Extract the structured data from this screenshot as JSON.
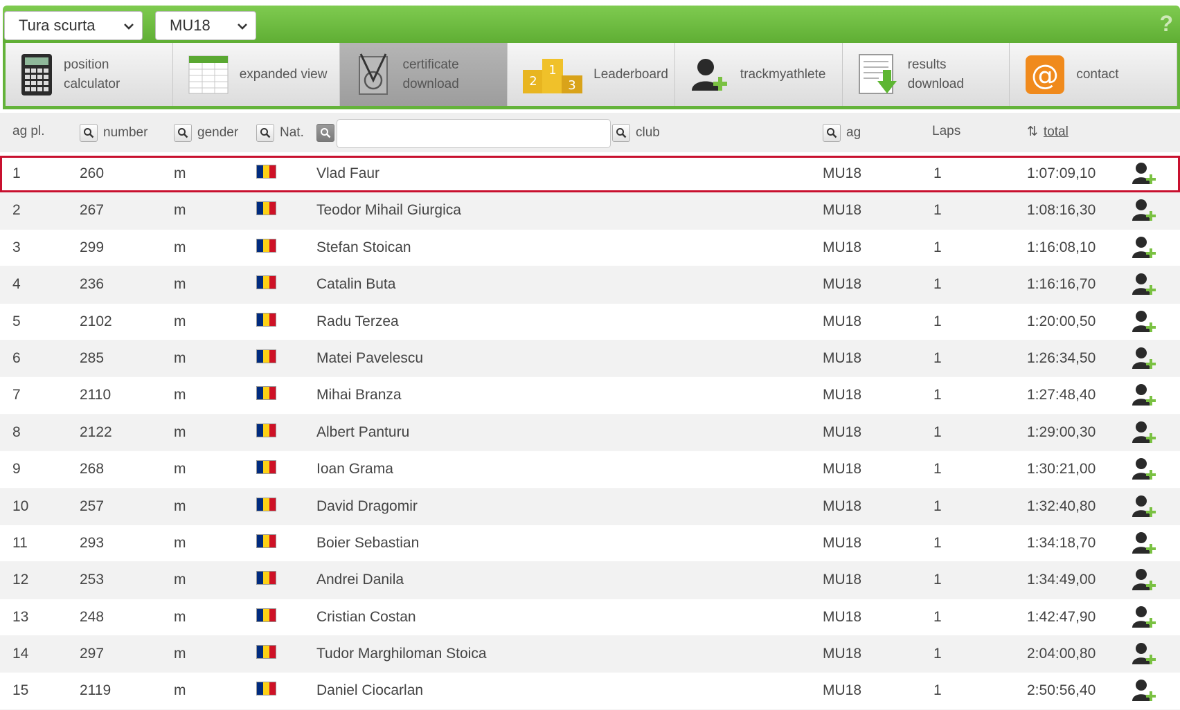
{
  "filters": {
    "race": "Tura scurta",
    "category": "MU18",
    "help_label": "?"
  },
  "toolbar": [
    {
      "line1": "position",
      "line2": "calculator",
      "icon": "calculator-icon"
    },
    {
      "line1": "expanded view",
      "line2": "",
      "icon": "spreadsheet-icon"
    },
    {
      "line1": "certificate",
      "line2": "download",
      "icon": "certificate-icon"
    },
    {
      "line1": "Leaderboard",
      "line2": "",
      "icon": "podium-icon"
    },
    {
      "line1": "trackmyathlete",
      "line2": "",
      "icon": "add-person-icon"
    },
    {
      "line1": "results",
      "line2": "download",
      "icon": "download-document-icon"
    },
    {
      "line1": "contact",
      "line2": "",
      "icon": "at-sign-icon"
    }
  ],
  "podium": {
    "first": "1",
    "second": "2",
    "third": "3"
  },
  "columns": {
    "ag_pl": "ag pl.",
    "number": "number",
    "gender": "gender",
    "nat": "Nat.",
    "club": "club",
    "ag": "ag",
    "laps": "Laps",
    "total": "total",
    "sort_glyph": "⇅"
  },
  "flag_colors": [
    "#002b7f",
    "#fcd116",
    "#ce1126"
  ],
  "rows": [
    {
      "pl": "1",
      "num": "260",
      "gender": "m",
      "name": "Vlad Faur",
      "ag": "MU18",
      "laps": "1",
      "total": "1:07:09,10"
    },
    {
      "pl": "2",
      "num": "267",
      "gender": "m",
      "name": "Teodor Mihail Giurgica",
      "ag": "MU18",
      "laps": "1",
      "total": "1:08:16,30"
    },
    {
      "pl": "3",
      "num": "299",
      "gender": "m",
      "name": "Stefan Stoican",
      "ag": "MU18",
      "laps": "1",
      "total": "1:16:08,10"
    },
    {
      "pl": "4",
      "num": "236",
      "gender": "m",
      "name": "Catalin Buta",
      "ag": "MU18",
      "laps": "1",
      "total": "1:16:16,70"
    },
    {
      "pl": "5",
      "num": "2102",
      "gender": "m",
      "name": "Radu Terzea",
      "ag": "MU18",
      "laps": "1",
      "total": "1:20:00,50"
    },
    {
      "pl": "6",
      "num": "285",
      "gender": "m",
      "name": "Matei Pavelescu",
      "ag": "MU18",
      "laps": "1",
      "total": "1:26:34,50"
    },
    {
      "pl": "7",
      "num": "2110",
      "gender": "m",
      "name": "Mihai Branza",
      "ag": "MU18",
      "laps": "1",
      "total": "1:27:48,40"
    },
    {
      "pl": "8",
      "num": "2122",
      "gender": "m",
      "name": "Albert Panturu",
      "ag": "MU18",
      "laps": "1",
      "total": "1:29:00,30"
    },
    {
      "pl": "9",
      "num": "268",
      "gender": "m",
      "name": "Ioan Grama",
      "ag": "MU18",
      "laps": "1",
      "total": "1:30:21,00"
    },
    {
      "pl": "10",
      "num": "257",
      "gender": "m",
      "name": "David Dragomir",
      "ag": "MU18",
      "laps": "1",
      "total": "1:32:40,80"
    },
    {
      "pl": "11",
      "num": "293",
      "gender": "m",
      "name": "Boier Sebastian",
      "ag": "MU18",
      "laps": "1",
      "total": "1:34:18,70"
    },
    {
      "pl": "12",
      "num": "253",
      "gender": "m",
      "name": "Andrei Danila",
      "ag": "MU18",
      "laps": "1",
      "total": "1:34:49,00"
    },
    {
      "pl": "13",
      "num": "248",
      "gender": "m",
      "name": "Cristian Costan",
      "ag": "MU18",
      "laps": "1",
      "total": "1:42:47,90"
    },
    {
      "pl": "14",
      "num": "297",
      "gender": "m",
      "name": "Tudor Marghiloman Stoica",
      "ag": "MU18",
      "laps": "1",
      "total": "2:04:00,80"
    },
    {
      "pl": "15",
      "num": "2119",
      "gender": "m",
      "name": "Daniel Ciocarlan",
      "ag": "MU18",
      "laps": "1",
      "total": "2:50:56,40"
    }
  ]
}
